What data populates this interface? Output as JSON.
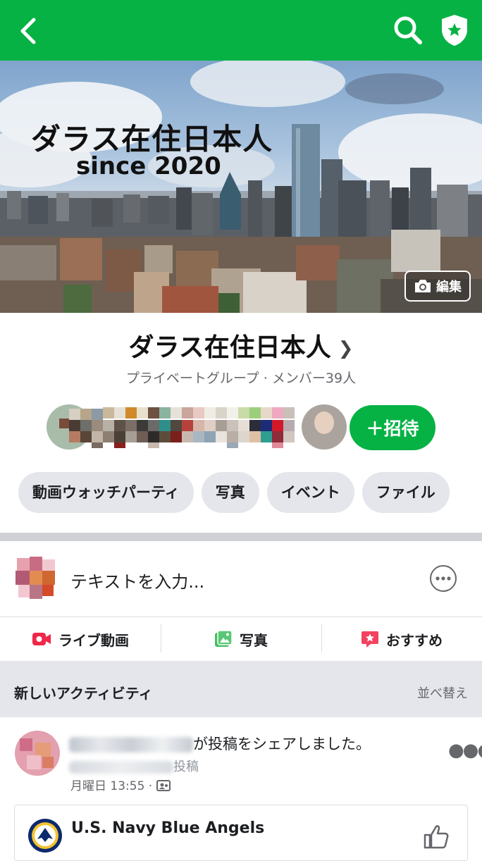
{
  "header": {
    "back_icon": "chevron-left-icon",
    "search_icon": "search-icon",
    "admin_icon": "shield-star-icon",
    "bg_color": "#06b244"
  },
  "cover": {
    "title": "ダラス在住日本人",
    "subtitle": "since 2020",
    "edit_label": "編集"
  },
  "group": {
    "name": "ダラス在住日本人",
    "meta": "プライベートグループ · メンバー39人",
    "invite_label": "＋招待"
  },
  "chips": [
    "動画ウォッチパーティ",
    "写真",
    "イベント",
    "ファイル"
  ],
  "composer": {
    "placeholder": "テキストを入力..."
  },
  "actions": [
    {
      "label": "ライブ動画",
      "icon": "live-video-icon",
      "color": "#f02849"
    },
    {
      "label": "写真",
      "icon": "photo-icon",
      "color": "#45bd62"
    },
    {
      "label": "おすすめ",
      "icon": "recommend-icon",
      "color": "#f3425f"
    }
  ],
  "activity": {
    "title": "新しいアクティビティ",
    "sort_label": "並べ替え"
  },
  "post": {
    "action_text": "が投稿をシェアしました。",
    "sub_text": "投稿",
    "time": "月曜日 13:55 ·",
    "shared_page_name": "U.S. Navy Blue Angels"
  }
}
